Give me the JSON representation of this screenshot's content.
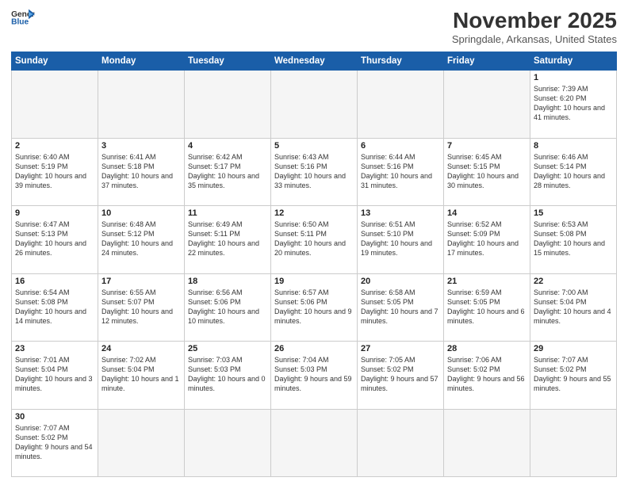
{
  "header": {
    "logo_general": "General",
    "logo_blue": "Blue",
    "title": "November 2025",
    "subtitle": "Springdale, Arkansas, United States"
  },
  "days_of_week": [
    "Sunday",
    "Monday",
    "Tuesday",
    "Wednesday",
    "Thursday",
    "Friday",
    "Saturday"
  ],
  "weeks": [
    [
      {
        "day": "",
        "info": ""
      },
      {
        "day": "",
        "info": ""
      },
      {
        "day": "",
        "info": ""
      },
      {
        "day": "",
        "info": ""
      },
      {
        "day": "",
        "info": ""
      },
      {
        "day": "",
        "info": ""
      },
      {
        "day": "1",
        "info": "Sunrise: 7:39 AM\nSunset: 6:20 PM\nDaylight: 10 hours and 41 minutes."
      }
    ],
    [
      {
        "day": "2",
        "info": "Sunrise: 6:40 AM\nSunset: 5:19 PM\nDaylight: 10 hours and 39 minutes."
      },
      {
        "day": "3",
        "info": "Sunrise: 6:41 AM\nSunset: 5:18 PM\nDaylight: 10 hours and 37 minutes."
      },
      {
        "day": "4",
        "info": "Sunrise: 6:42 AM\nSunset: 5:17 PM\nDaylight: 10 hours and 35 minutes."
      },
      {
        "day": "5",
        "info": "Sunrise: 6:43 AM\nSunset: 5:16 PM\nDaylight: 10 hours and 33 minutes."
      },
      {
        "day": "6",
        "info": "Sunrise: 6:44 AM\nSunset: 5:16 PM\nDaylight: 10 hours and 31 minutes."
      },
      {
        "day": "7",
        "info": "Sunrise: 6:45 AM\nSunset: 5:15 PM\nDaylight: 10 hours and 30 minutes."
      },
      {
        "day": "8",
        "info": "Sunrise: 6:46 AM\nSunset: 5:14 PM\nDaylight: 10 hours and 28 minutes."
      }
    ],
    [
      {
        "day": "9",
        "info": "Sunrise: 6:47 AM\nSunset: 5:13 PM\nDaylight: 10 hours and 26 minutes."
      },
      {
        "day": "10",
        "info": "Sunrise: 6:48 AM\nSunset: 5:12 PM\nDaylight: 10 hours and 24 minutes."
      },
      {
        "day": "11",
        "info": "Sunrise: 6:49 AM\nSunset: 5:11 PM\nDaylight: 10 hours and 22 minutes."
      },
      {
        "day": "12",
        "info": "Sunrise: 6:50 AM\nSunset: 5:11 PM\nDaylight: 10 hours and 20 minutes."
      },
      {
        "day": "13",
        "info": "Sunrise: 6:51 AM\nSunset: 5:10 PM\nDaylight: 10 hours and 19 minutes."
      },
      {
        "day": "14",
        "info": "Sunrise: 6:52 AM\nSunset: 5:09 PM\nDaylight: 10 hours and 17 minutes."
      },
      {
        "day": "15",
        "info": "Sunrise: 6:53 AM\nSunset: 5:08 PM\nDaylight: 10 hours and 15 minutes."
      }
    ],
    [
      {
        "day": "16",
        "info": "Sunrise: 6:54 AM\nSunset: 5:08 PM\nDaylight: 10 hours and 14 minutes."
      },
      {
        "day": "17",
        "info": "Sunrise: 6:55 AM\nSunset: 5:07 PM\nDaylight: 10 hours and 12 minutes."
      },
      {
        "day": "18",
        "info": "Sunrise: 6:56 AM\nSunset: 5:06 PM\nDaylight: 10 hours and 10 minutes."
      },
      {
        "day": "19",
        "info": "Sunrise: 6:57 AM\nSunset: 5:06 PM\nDaylight: 10 hours and 9 minutes."
      },
      {
        "day": "20",
        "info": "Sunrise: 6:58 AM\nSunset: 5:05 PM\nDaylight: 10 hours and 7 minutes."
      },
      {
        "day": "21",
        "info": "Sunrise: 6:59 AM\nSunset: 5:05 PM\nDaylight: 10 hours and 6 minutes."
      },
      {
        "day": "22",
        "info": "Sunrise: 7:00 AM\nSunset: 5:04 PM\nDaylight: 10 hours and 4 minutes."
      }
    ],
    [
      {
        "day": "23",
        "info": "Sunrise: 7:01 AM\nSunset: 5:04 PM\nDaylight: 10 hours and 3 minutes."
      },
      {
        "day": "24",
        "info": "Sunrise: 7:02 AM\nSunset: 5:04 PM\nDaylight: 10 hours and 1 minute."
      },
      {
        "day": "25",
        "info": "Sunrise: 7:03 AM\nSunset: 5:03 PM\nDaylight: 10 hours and 0 minutes."
      },
      {
        "day": "26",
        "info": "Sunrise: 7:04 AM\nSunset: 5:03 PM\nDaylight: 9 hours and 59 minutes."
      },
      {
        "day": "27",
        "info": "Sunrise: 7:05 AM\nSunset: 5:02 PM\nDaylight: 9 hours and 57 minutes."
      },
      {
        "day": "28",
        "info": "Sunrise: 7:06 AM\nSunset: 5:02 PM\nDaylight: 9 hours and 56 minutes."
      },
      {
        "day": "29",
        "info": "Sunrise: 7:07 AM\nSunset: 5:02 PM\nDaylight: 9 hours and 55 minutes."
      }
    ],
    [
      {
        "day": "30",
        "info": "Sunrise: 7:07 AM\nSunset: 5:02 PM\nDaylight: 9 hours and 54 minutes."
      },
      {
        "day": "",
        "info": ""
      },
      {
        "day": "",
        "info": ""
      },
      {
        "day": "",
        "info": ""
      },
      {
        "day": "",
        "info": ""
      },
      {
        "day": "",
        "info": ""
      },
      {
        "day": "",
        "info": ""
      }
    ]
  ]
}
